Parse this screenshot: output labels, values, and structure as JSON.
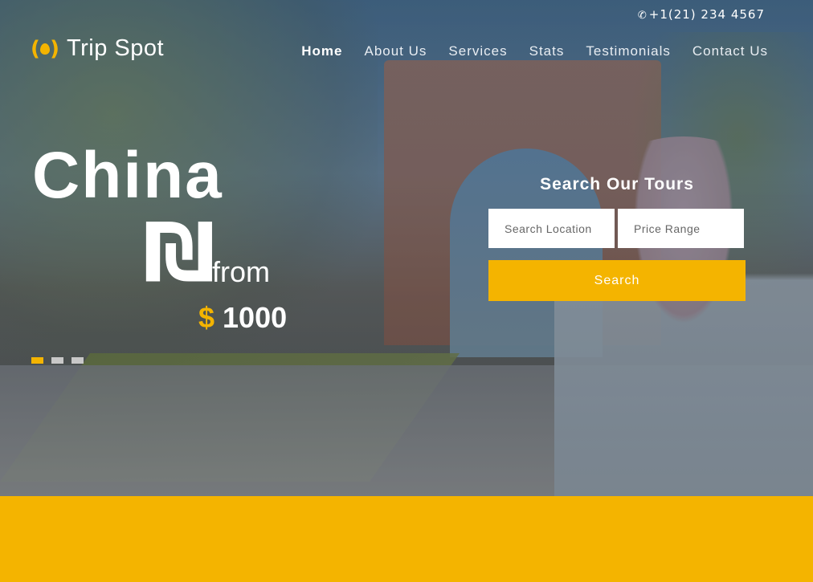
{
  "topbar": {
    "phone": "+1(21) 234 4567",
    "phone_icon": "phone-icon"
  },
  "brand": {
    "name": "Trip Spot",
    "logo_icon": "flame-logo-icon"
  },
  "nav": {
    "items": [
      {
        "label": "Home",
        "active": true
      },
      {
        "label": "About Us"
      },
      {
        "label": "Services"
      },
      {
        "label": "Stats"
      },
      {
        "label": "Testimonials"
      },
      {
        "label": "Contact Us"
      }
    ]
  },
  "hero": {
    "title": "China",
    "currency_glyph": "₪",
    "from": "from",
    "price_symbol": "$",
    "price_amount": "1000",
    "slides": {
      "count": 3,
      "active": 1
    }
  },
  "search": {
    "title": "Search Our Tours",
    "location_placeholder": "Search Location",
    "price_placeholder": "Price Range",
    "button_label": "Search"
  },
  "colors": {
    "accent": "#f4b400",
    "text": "#ffffff"
  }
}
